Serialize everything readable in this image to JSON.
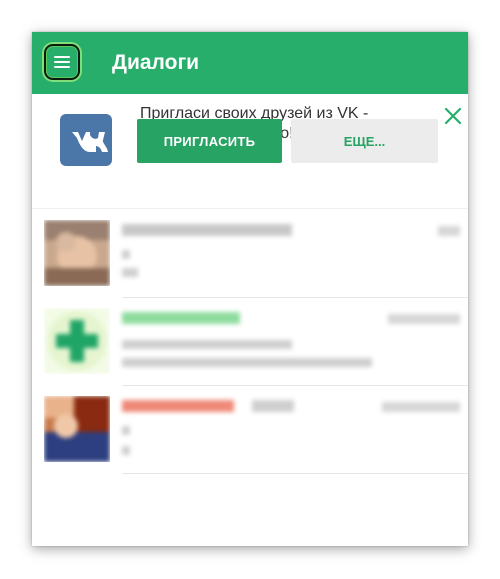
{
  "header": {
    "title": "Диалоги",
    "menu_icon": "hamburger-menu-icon",
    "color": "#27ae6b"
  },
  "invite_banner": {
    "logo_icon": "vk-logo-icon",
    "logo_text": "VK",
    "text": "Пригласи своих друзей из VK - бесплатно и быстро!",
    "close_icon": "close-icon",
    "invite_button": "ПРИГЛАСИТЬ",
    "more_button": "ЕЩЕ...",
    "accent": "#27a363"
  },
  "dialogs": [
    {
      "avatar_icon": "user-avatar-photo",
      "name_color": "#cfcfcf"
    },
    {
      "avatar_icon": "green-cross-avatar",
      "name_color": "#8fdc9f"
    },
    {
      "avatar_icon": "user-avatar-photo",
      "name_color": "#f08a78"
    }
  ]
}
